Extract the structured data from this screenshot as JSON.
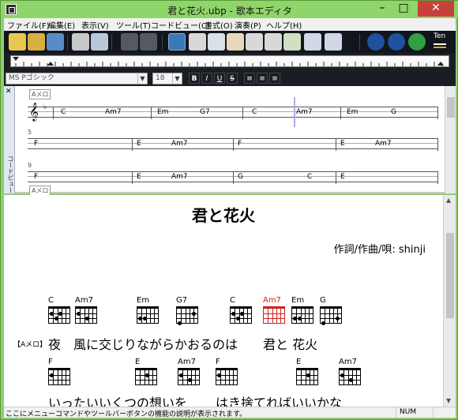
{
  "window": {
    "title": "君と花火.ubp - 歌本エディタ"
  },
  "menubar": {
    "items": [
      "ファイル(F)",
      "編集(E)",
      "表示(V)",
      "ツール(T)",
      "コードビュー(C)",
      "書式(O)",
      "演奏(P)",
      "ヘルプ(H)"
    ]
  },
  "toolbar": {
    "ten_label": "Ten",
    "icons": [
      "new-file-icon",
      "open-file-icon",
      "save-icon",
      "print-icon",
      "print-preview-icon",
      "undo-icon",
      "redo-icon",
      "chord-tool-icon",
      "select-tool-icon",
      "chord-select-icon",
      "zoom-icon",
      "zoom-chord-icon",
      "chord-zoom-icon",
      "chord-add-icon",
      "chord-tool-2-icon",
      "chord-tool-3-icon",
      "rewind-icon",
      "stop-icon",
      "play-icon",
      "tempo-icon"
    ]
  },
  "formatbar": {
    "font_value": "MS Pゴシック",
    "size_value": "18",
    "buttons": [
      "B",
      "I",
      "U",
      "S",
      "≡",
      "≡",
      "≡"
    ]
  },
  "chordview": {
    "side_label": "コードビュー",
    "section_tag_top": "Aメロ",
    "section_tag_bottom": "Aメロ",
    "measure_numbers": [
      "5",
      "9"
    ],
    "rows": [
      {
        "chords": [
          {
            "name": "C"
          },
          {
            "name": "Am7"
          },
          {
            "name": "Em"
          },
          {
            "name": "G7"
          },
          {
            "name": "C"
          },
          {
            "name": "Am7"
          },
          {
            "name": "Em"
          },
          {
            "name": "G"
          }
        ]
      },
      {
        "chords": [
          {
            "name": "F"
          },
          {
            "name": "E"
          },
          {
            "name": "Am7"
          },
          {
            "name": "F"
          },
          {
            "name": "E"
          },
          {
            "name": "Am7"
          }
        ]
      },
      {
        "chords": [
          {
            "name": "F"
          },
          {
            "name": "E"
          },
          {
            "name": "Am7"
          },
          {
            "name": "G"
          },
          {
            "name": "C"
          },
          {
            "name": "E"
          }
        ]
      }
    ]
  },
  "document": {
    "title": "君と花火",
    "credit": "作詞/作曲/唄: shinji",
    "section_label": "【Aメロ】",
    "line1_chords": [
      "C",
      "Am7",
      "Em",
      "G7",
      "C",
      "Am7",
      "Em",
      "G"
    ],
    "line1_lyric_a": "夜　風に交じりながらかおるのは",
    "line1_lyric_b": "君と 花火",
    "line2_chords": [
      "F",
      "E",
      "Am7",
      "F",
      "E",
      "Am7"
    ],
    "line2_lyric_a": "いったいいくつの想いを",
    "line2_lyric_b": "はき捨てればいいかな",
    "highlight_color": "#d02020"
  },
  "statusbar": {
    "text": "ここにメニューコマンドやツールバーボタンの機能の説明が表示されます。",
    "num": "NUM"
  }
}
